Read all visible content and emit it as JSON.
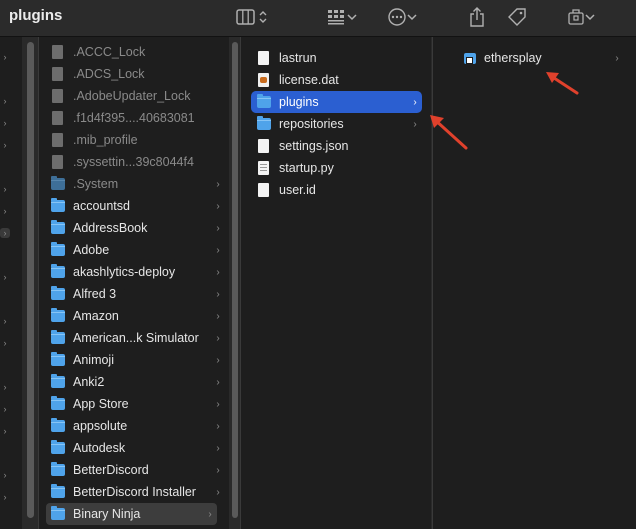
{
  "window": {
    "title": "plugins"
  },
  "toolbar": {
    "view_switcher_icon": "columns-view-icon",
    "group_icon": "grid-group-icon",
    "action_icon": "ellipsis-circle-icon",
    "share_icon": "share-icon",
    "tag_icon": "tag-icon",
    "extension_icon": "extension-icon"
  },
  "column1": {
    "items": [
      {
        "label": ".ACCC_Lock",
        "kind": "file",
        "hidden": true
      },
      {
        "label": ".ADCS_Lock",
        "kind": "file",
        "hidden": true
      },
      {
        "label": ".AdobeUpdater_Lock",
        "kind": "file",
        "hidden": true
      },
      {
        "label": ".f1d4f395....40683081",
        "kind": "file",
        "hidden": true
      },
      {
        "label": ".mib_profile",
        "kind": "file",
        "hidden": true
      },
      {
        "label": ".syssettin...39c8044f4",
        "kind": "file",
        "hidden": true
      },
      {
        "label": ".System",
        "kind": "folder",
        "hidden": true
      },
      {
        "label": "accountsd",
        "kind": "folder"
      },
      {
        "label": "AddressBook",
        "kind": "folder"
      },
      {
        "label": "Adobe",
        "kind": "folder"
      },
      {
        "label": "akashlytics-deploy",
        "kind": "folder"
      },
      {
        "label": "Alfred 3",
        "kind": "folder"
      },
      {
        "label": "Amazon",
        "kind": "folder"
      },
      {
        "label": "American...k Simulator",
        "kind": "folder"
      },
      {
        "label": "Animoji",
        "kind": "folder"
      },
      {
        "label": "Anki2",
        "kind": "folder"
      },
      {
        "label": "App Store",
        "kind": "folder"
      },
      {
        "label": "appsolute",
        "kind": "folder"
      },
      {
        "label": "Autodesk",
        "kind": "folder"
      },
      {
        "label": "BetterDiscord",
        "kind": "folder"
      },
      {
        "label": "BetterDiscord Installer",
        "kind": "folder"
      },
      {
        "label": "Binary Ninja",
        "kind": "folder",
        "state": "active-parent"
      }
    ]
  },
  "column2": {
    "items": [
      {
        "label": "lastrun",
        "kind": "file"
      },
      {
        "label": "license.dat",
        "kind": "dat"
      },
      {
        "label": "plugins",
        "kind": "folder",
        "state": "selected"
      },
      {
        "label": "repositories",
        "kind": "folder"
      },
      {
        "label": "settings.json",
        "kind": "file"
      },
      {
        "label": "startup.py",
        "kind": "py"
      },
      {
        "label": "user.id",
        "kind": "file"
      }
    ]
  },
  "column3": {
    "items": [
      {
        "label": "ethersplay",
        "kind": "alias-folder"
      }
    ]
  },
  "colors": {
    "selection": "#2b5fd1",
    "folder": "#4fa3ea",
    "annotation_arrow": "#e0412c"
  }
}
